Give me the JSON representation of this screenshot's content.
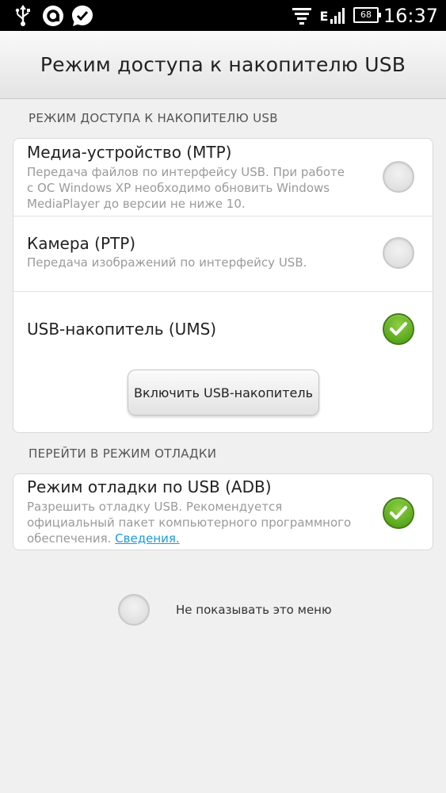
{
  "status_bar": {
    "time": "16:37",
    "battery": "68",
    "network": "E",
    "icons": [
      "usb-icon",
      "app-notification-icon",
      "checkmark-notification-icon",
      "signal-bars-icon",
      "battery-icon"
    ]
  },
  "title": "Режим доступа к накопителю USB",
  "sections": {
    "usb_mode": {
      "header": "РЕЖИМ ДОСТУПА К НАКОПИТЕЛЮ USB",
      "options": [
        {
          "title": "Медиа-устройство (MTP)",
          "description": "Передача файлов по интерфейсу USB. При работе с ОС Windows XP необходимо обновить Windows MediaPlayer до версии не ниже 10.",
          "checked": false
        },
        {
          "title": "Камера (PTP)",
          "description": "Передача изображений по интерфейсу USB.",
          "checked": false
        },
        {
          "title": "USB-накопитель (UMS)",
          "description": "",
          "checked": true
        }
      ],
      "button_label": "Включить USB-накопитель"
    },
    "debug": {
      "header": "ПЕРЕЙТИ В РЕЖИМ ОТЛАДКИ",
      "title": "Режим отладки по USB (ADB)",
      "description": "Разрешить отладку USB. Рекомендуется официальный пакет компьютерного программного обеспечения.",
      "link": "Сведения.",
      "checked": true
    }
  },
  "dont_show": {
    "label": "Не показывать это меню",
    "checked": false
  },
  "colors": {
    "check_on": "#5aa81e",
    "link": "#1e9bd6",
    "status_bar": "#000000"
  }
}
